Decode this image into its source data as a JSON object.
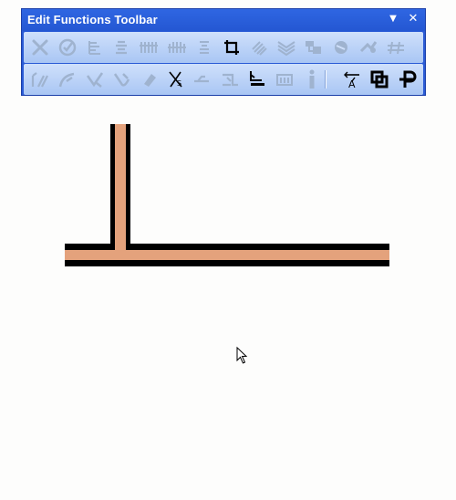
{
  "window": {
    "title": "Edit Functions Toolbar",
    "menu_glyph": "▼",
    "close_glyph": "✕"
  },
  "colors": {
    "title_bar": "#2457d2",
    "toolbar_body": "#bcd3f7",
    "icon_disabled": "#9fb3cf",
    "icon_enabled": "#000000",
    "wall_fill": "#e4a27c",
    "wall_outline": "#000000"
  },
  "toolbar": {
    "row1": [
      {
        "icon": "delete-icon",
        "enabled": false
      },
      {
        "icon": "check-icon",
        "enabled": false
      },
      {
        "icon": "align-left-icon",
        "enabled": false
      },
      {
        "icon": "align-center-icon",
        "enabled": false
      },
      {
        "icon": "vertical-lines-icon",
        "enabled": false
      },
      {
        "icon": "vertical-lines-alt-icon",
        "enabled": false
      },
      {
        "icon": "stack-lines-icon",
        "enabled": false
      },
      {
        "icon": "crop-icon",
        "enabled": true
      },
      {
        "icon": "hatch-icon",
        "enabled": false
      },
      {
        "icon": "layers-icon",
        "enabled": false
      },
      {
        "icon": "offset-icon",
        "enabled": false
      },
      {
        "icon": "rotate-icon",
        "enabled": false
      },
      {
        "icon": "move-icon",
        "enabled": false
      },
      {
        "icon": "hash-icon",
        "enabled": false
      }
    ],
    "row2": [
      {
        "icon": "split-icon",
        "enabled": false
      },
      {
        "icon": "curve-icon",
        "enabled": false
      },
      {
        "icon": "join-icon",
        "enabled": false
      },
      {
        "icon": "fillet-icon",
        "enabled": false
      },
      {
        "icon": "eraser-icon",
        "enabled": false
      },
      {
        "icon": "stretch-icon",
        "enabled": false
      },
      {
        "icon": "extend-icon",
        "enabled": false
      },
      {
        "icon": "trim-icon",
        "enabled": false
      },
      {
        "icon": "wall-align-icon",
        "enabled": true
      },
      {
        "icon": "wall-end-icon",
        "enabled": false
      },
      {
        "icon": "info-icon",
        "enabled": false
      },
      {
        "icon": "text-edit-icon",
        "enabled": true
      },
      {
        "icon": "copy-icon",
        "enabled": true
      },
      {
        "icon": "pin-icon",
        "enabled": true
      }
    ]
  },
  "drawing": {
    "description_free": true
  }
}
